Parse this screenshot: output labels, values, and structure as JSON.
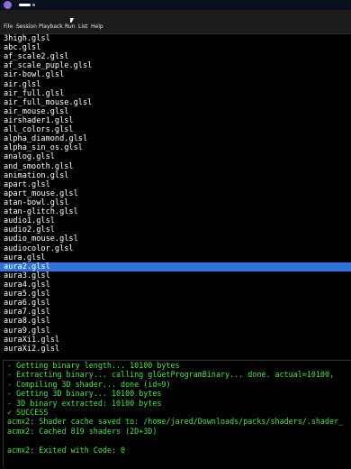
{
  "menu": [
    "File",
    "Session",
    "Playback",
    "Run",
    "List",
    "Help"
  ],
  "files": [
    "3high.glsl",
    "abc.glsl",
    "af_scale2.glsl",
    "af_scale_puple.glsl",
    "air-bowl.glsl",
    "air.glsl",
    "air_full.glsl",
    "air_full_mouse.glsl",
    "air_mouse.glsl",
    "airshader1.glsl",
    "all_colors.glsl",
    "alpha_diamond.glsl",
    "alpha_sin_os.glsl",
    "analog.glsl",
    "and_smooth.glsl",
    "animation.glsl",
    "apart.glsl",
    "apart_mouse.glsl",
    "atan-bowl.glsl",
    "atan-glitch.glsl",
    "audio1.glsl",
    "audio2.glsl",
    "audio_mouse.glsl",
    "audiocolor.glsl",
    "aura.glsl",
    "aura2.glsl",
    "aura3.glsl",
    "aura4.glsl",
    "aura5.glsl",
    "aura6.glsl",
    "aura7.glsl",
    "aura8.glsl",
    "aura9.glsl",
    "auraXi1.glsl",
    "auraXi2.glsl"
  ],
  "selected_index": 25,
  "terminal": [
    {
      "text": "- Getting binary length... 10100 bytes",
      "color": "green"
    },
    {
      "text": "- Extracting binary... calling glGetProgramBinary... done. actual=10100, ",
      "color": "green"
    },
    {
      "text": "- Compiling 3D shader... done (id=9)",
      "color": "green"
    },
    {
      "text": "- Getting 3D binary... 10100 bytes",
      "color": "green"
    },
    {
      "text": "- 3D binary extracted: 10100 bytes",
      "color": "green"
    },
    {
      "text": "✓ SUCCESS",
      "color": "green"
    },
    {
      "text": "acmx2: Shader cache saved to: /home/jared/Downloads/packs/shaders/.shader_",
      "color": "green"
    },
    {
      "text": "acmx2: Cached 819 shaders (2D+3D)",
      "color": "green"
    },
    {
      "text": "",
      "color": "white"
    },
    {
      "text": "acmx2: Exited with Code: 0",
      "color": "green"
    }
  ]
}
